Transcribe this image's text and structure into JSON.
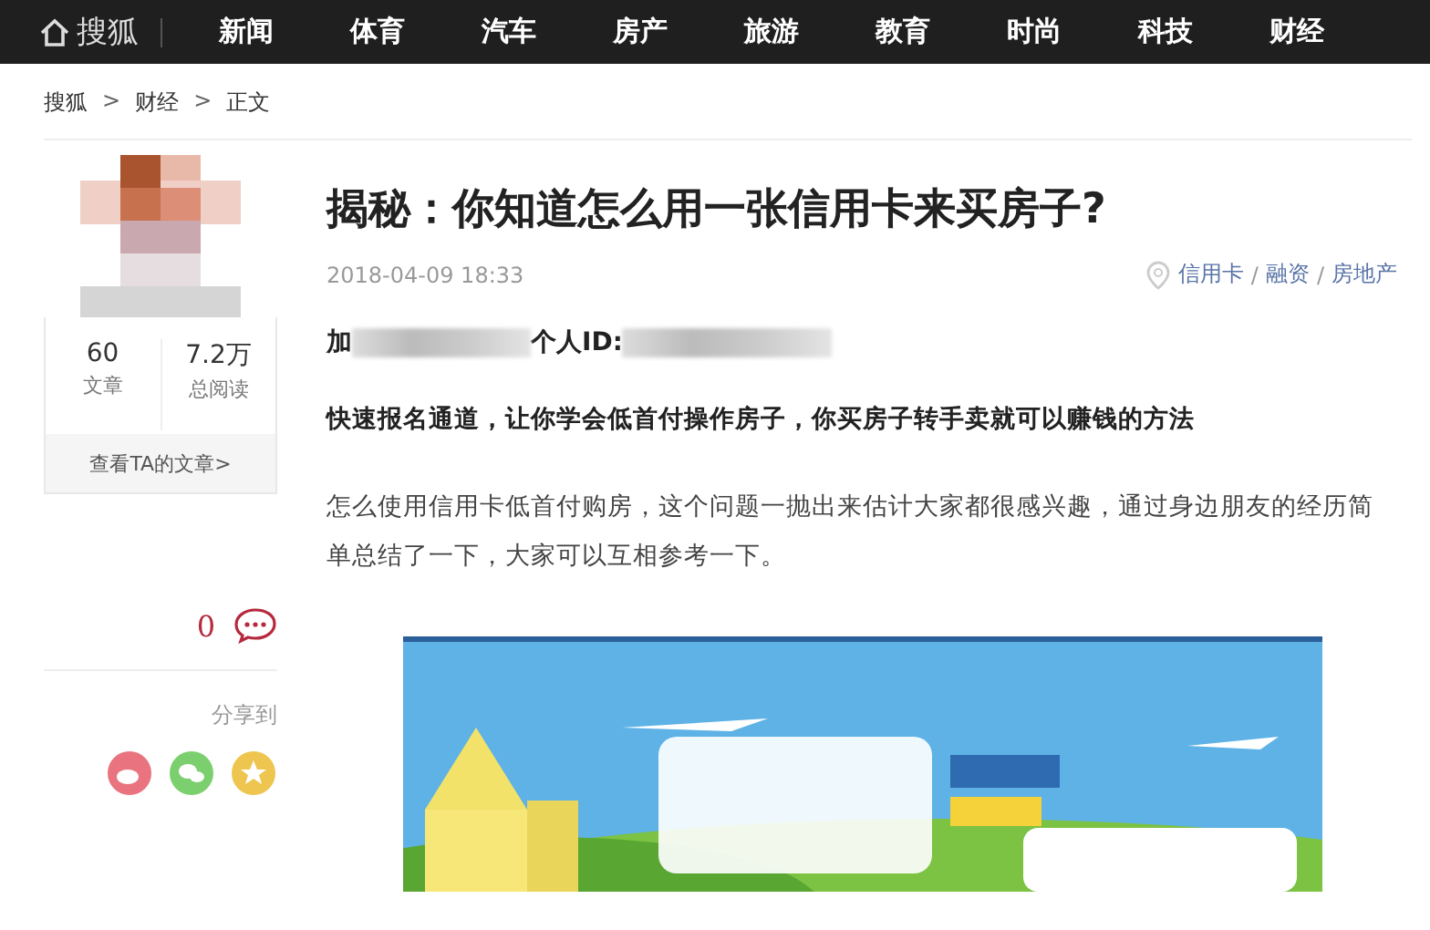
{
  "nav": {
    "logo": "搜狐",
    "items": [
      "新闻",
      "体育",
      "汽车",
      "房产",
      "旅游",
      "教育",
      "时尚",
      "科技",
      "财经"
    ]
  },
  "breadcrumb": [
    "搜狐",
    "财经",
    "正文"
  ],
  "breadcrumb_separator": ">",
  "author": {
    "stats": [
      {
        "value": "60",
        "label": "文章"
      },
      {
        "value": "7.2万",
        "label": "总阅读"
      }
    ],
    "link": "查看TA的文章>"
  },
  "comments": {
    "count": "0"
  },
  "share": {
    "label": "分享到"
  },
  "article": {
    "title": "揭秘：你知道怎么用一张信用卡来买房子?",
    "date": "2018-04-09 18:33",
    "tags": [
      "信用卡",
      "融资",
      "房地产"
    ],
    "tag_separator": "/",
    "contact": {
      "prefix": "加",
      "id_label": "个人ID:"
    },
    "lead": "快速报名通道，让你学会低首付操作房子，你买房子转手卖就可以赚钱的方法",
    "paragraph": "怎么使用信用卡低首付购房，这个问题一抛出来估计大家都很感兴趣，通过身边朋友的经历简单总结了一下，大家可以互相参考一下。"
  }
}
